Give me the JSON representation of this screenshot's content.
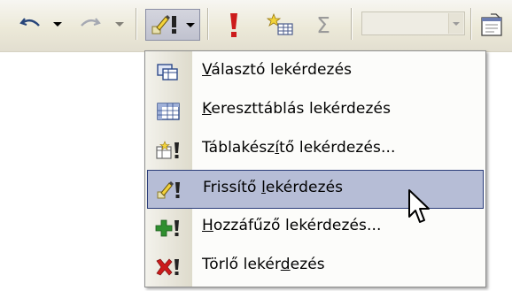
{
  "toolbar": {
    "undo_icon": "undo-icon",
    "redo_icon": "redo-icon",
    "query_type_icon": "query-type-icon",
    "run_icon": "run-exclamation-icon",
    "show_table_icon": "show-table-icon",
    "totals_symbol": "Σ",
    "combo_value": "",
    "properties_icon": "properties-icon"
  },
  "menu": {
    "items": [
      {
        "id": "select",
        "prefix": "",
        "accel": "V",
        "rest": "álasztó lekérdezés",
        "icon": "select-query-icon"
      },
      {
        "id": "crosstab",
        "prefix": "",
        "accel": "K",
        "rest": "ereszttáblás lekérdezés",
        "icon": "crosstab-query-icon"
      },
      {
        "id": "make-table",
        "prefix": "Táblakész",
        "accel": "í",
        "rest": "tő lekérdezés...",
        "icon": "make-table-query-icon"
      },
      {
        "id": "update",
        "prefix": "Frissítő ",
        "accel": "l",
        "rest": "ekérdezés",
        "icon": "update-query-icon",
        "highlighted": true
      },
      {
        "id": "append",
        "prefix": "",
        "accel": "H",
        "rest": "ozzáfűző lekérdezés...",
        "icon": "append-query-icon"
      },
      {
        "id": "delete",
        "prefix": "Törlő lekér",
        "accel": "d",
        "rest": "ezés",
        "icon": "delete-query-icon"
      }
    ]
  },
  "colors": {
    "highlight": "#b6bdd6",
    "highlight_border": "#2b3d7a",
    "exclamation": "#cc1b1b",
    "plus": "#2f8f2f"
  }
}
